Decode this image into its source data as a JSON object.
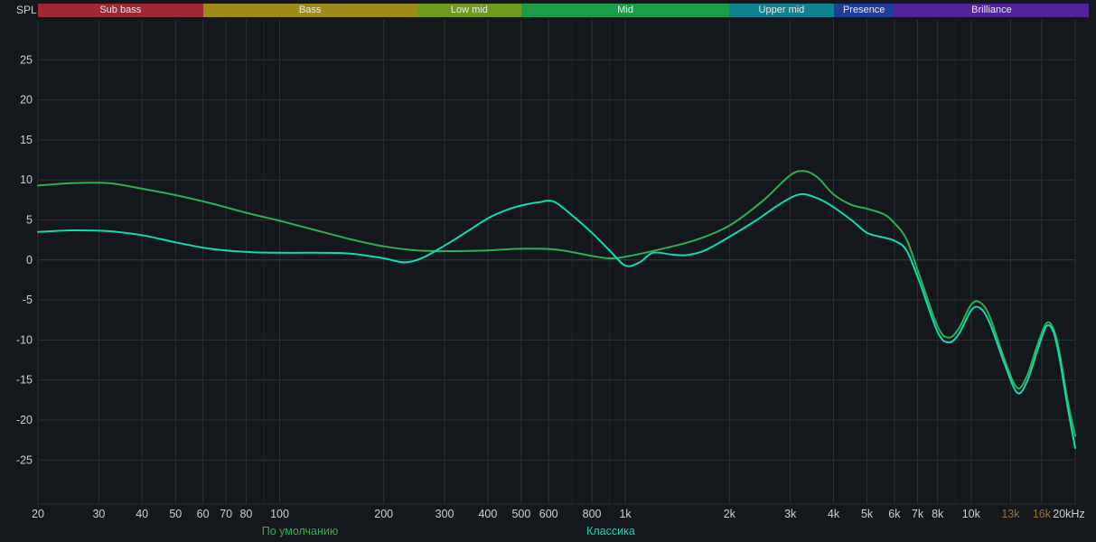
{
  "colors": {
    "background": "#14171b",
    "grid_minor": "#22262c",
    "grid_major": "#2c3138",
    "grid_zero": "#353c44",
    "axis_text": "#cdd1d5",
    "axis_text_muted": "#9a7040",
    "band_text": "#eaeaec"
  },
  "bands": [
    {
      "label": "Sub bass",
      "from": 20,
      "to": 60,
      "color": "#a02734"
    },
    {
      "label": "Bass",
      "from": 60,
      "to": 250,
      "color": "#9d8a1a"
    },
    {
      "label": "Low mid",
      "from": 250,
      "to": 500,
      "color": "#6f9a1e"
    },
    {
      "label": "Mid",
      "from": 500,
      "to": 2000,
      "color": "#1e9b46"
    },
    {
      "label": "Upper mid",
      "from": 2000,
      "to": 4000,
      "color": "#128090"
    },
    {
      "label": "Presence",
      "from": 4000,
      "to": 6000,
      "color": "#1f3e9c"
    },
    {
      "label": "Brilliance",
      "from": 6000,
      "to": 20000,
      "color": "#53239c"
    }
  ],
  "chart_data": {
    "type": "line",
    "title": "",
    "ylabel": "SPL",
    "xlabel": "",
    "x_scale": "log",
    "x_range": [
      20,
      20000
    ],
    "y_range": [
      -30.5,
      30
    ],
    "grid": true,
    "legend_position": "bottom",
    "y_ticks": [
      25,
      20,
      15,
      10,
      5,
      0,
      -5,
      -10,
      -15,
      -20,
      -25
    ],
    "x_ticks": [
      {
        "f": 20,
        "label": "20"
      },
      {
        "f": 30,
        "label": "30"
      },
      {
        "f": 40,
        "label": "40"
      },
      {
        "f": 50,
        "label": "50"
      },
      {
        "f": 60,
        "label": "60"
      },
      {
        "f": 70,
        "label": "70"
      },
      {
        "f": 80,
        "label": "80"
      },
      {
        "f": 100,
        "label": "100"
      },
      {
        "f": 200,
        "label": "200"
      },
      {
        "f": 300,
        "label": "300"
      },
      {
        "f": 400,
        "label": "400"
      },
      {
        "f": 500,
        "label": "500"
      },
      {
        "f": 600,
        "label": "600"
      },
      {
        "f": 800,
        "label": "800"
      },
      {
        "f": 1000,
        "label": "1k"
      },
      {
        "f": 2000,
        "label": "2k"
      },
      {
        "f": 3000,
        "label": "3k"
      },
      {
        "f": 4000,
        "label": "4k"
      },
      {
        "f": 5000,
        "label": "5k"
      },
      {
        "f": 6000,
        "label": "6k"
      },
      {
        "f": 7000,
        "label": "7k"
      },
      {
        "f": 8000,
        "label": "8k"
      },
      {
        "f": 10000,
        "label": "10k"
      },
      {
        "f": 13000,
        "label": "13k",
        "muted": true
      },
      {
        "f": 16000,
        "label": "16k",
        "muted": true
      },
      {
        "f": 20000,
        "label": "20kHz"
      }
    ],
    "series": [
      {
        "name": "По умолчанию",
        "color": "#2faf54",
        "points": [
          [
            20,
            9.3
          ],
          [
            25,
            9.6
          ],
          [
            32,
            9.6
          ],
          [
            40,
            8.9
          ],
          [
            50,
            8.1
          ],
          [
            63,
            7.1
          ],
          [
            80,
            5.9
          ],
          [
            100,
            4.9
          ],
          [
            125,
            3.8
          ],
          [
            160,
            2.6
          ],
          [
            200,
            1.7
          ],
          [
            250,
            1.2
          ],
          [
            315,
            1.1
          ],
          [
            400,
            1.2
          ],
          [
            500,
            1.4
          ],
          [
            630,
            1.3
          ],
          [
            800,
            0.5
          ],
          [
            900,
            0.2
          ],
          [
            1000,
            0.4
          ],
          [
            1250,
            1.3
          ],
          [
            1600,
            2.5
          ],
          [
            2000,
            4.3
          ],
          [
            2500,
            7.4
          ],
          [
            3000,
            10.6
          ],
          [
            3300,
            11.1
          ],
          [
            3600,
            10.3
          ],
          [
            4000,
            8.2
          ],
          [
            4500,
            6.9
          ],
          [
            5000,
            6.4
          ],
          [
            5600,
            5.7
          ],
          [
            6000,
            4.6
          ],
          [
            6500,
            2.6
          ],
          [
            7100,
            -2.0
          ],
          [
            8000,
            -8.3
          ],
          [
            8600,
            -9.7
          ],
          [
            9200,
            -8.6
          ],
          [
            10000,
            -5.6
          ],
          [
            10600,
            -5.3
          ],
          [
            11300,
            -7.0
          ],
          [
            12500,
            -12.5
          ],
          [
            13600,
            -16.0
          ],
          [
            14500,
            -14.5
          ],
          [
            15500,
            -10.8
          ],
          [
            16500,
            -7.9
          ],
          [
            17300,
            -8.6
          ],
          [
            18000,
            -11.5
          ],
          [
            19000,
            -17.5
          ],
          [
            20000,
            -22.0
          ]
        ]
      },
      {
        "name": "Классика",
        "color": "#0cdcb0",
        "points": [
          [
            20,
            3.5
          ],
          [
            25,
            3.7
          ],
          [
            32,
            3.6
          ],
          [
            40,
            3.1
          ],
          [
            50,
            2.2
          ],
          [
            63,
            1.4
          ],
          [
            80,
            1.0
          ],
          [
            100,
            0.9
          ],
          [
            125,
            0.9
          ],
          [
            160,
            0.8
          ],
          [
            200,
            0.2
          ],
          [
            230,
            -0.3
          ],
          [
            260,
            0.3
          ],
          [
            300,
            1.8
          ],
          [
            350,
            3.6
          ],
          [
            400,
            5.2
          ],
          [
            450,
            6.2
          ],
          [
            500,
            6.8
          ],
          [
            560,
            7.2
          ],
          [
            620,
            7.3
          ],
          [
            700,
            5.6
          ],
          [
            800,
            3.4
          ],
          [
            900,
            1.2
          ],
          [
            1000,
            -0.7
          ],
          [
            1100,
            -0.3
          ],
          [
            1200,
            0.9
          ],
          [
            1350,
            0.7
          ],
          [
            1500,
            0.6
          ],
          [
            1700,
            1.2
          ],
          [
            2000,
            2.9
          ],
          [
            2400,
            5.0
          ],
          [
            2800,
            7.0
          ],
          [
            3200,
            8.2
          ],
          [
            3600,
            7.7
          ],
          [
            4000,
            6.6
          ],
          [
            4500,
            5.0
          ],
          [
            5000,
            3.4
          ],
          [
            5600,
            2.8
          ],
          [
            6000,
            2.4
          ],
          [
            6500,
            1.2
          ],
          [
            7100,
            -2.8
          ],
          [
            8000,
            -9.0
          ],
          [
            8600,
            -10.3
          ],
          [
            9200,
            -9.3
          ],
          [
            10000,
            -6.3
          ],
          [
            10600,
            -6.0
          ],
          [
            11300,
            -7.8
          ],
          [
            12500,
            -13.0
          ],
          [
            13600,
            -16.6
          ],
          [
            14500,
            -15.2
          ],
          [
            15500,
            -11.5
          ],
          [
            16500,
            -8.3
          ],
          [
            17300,
            -9.0
          ],
          [
            18000,
            -12.2
          ],
          [
            19000,
            -18.3
          ],
          [
            20000,
            -23.5
          ]
        ]
      }
    ]
  }
}
